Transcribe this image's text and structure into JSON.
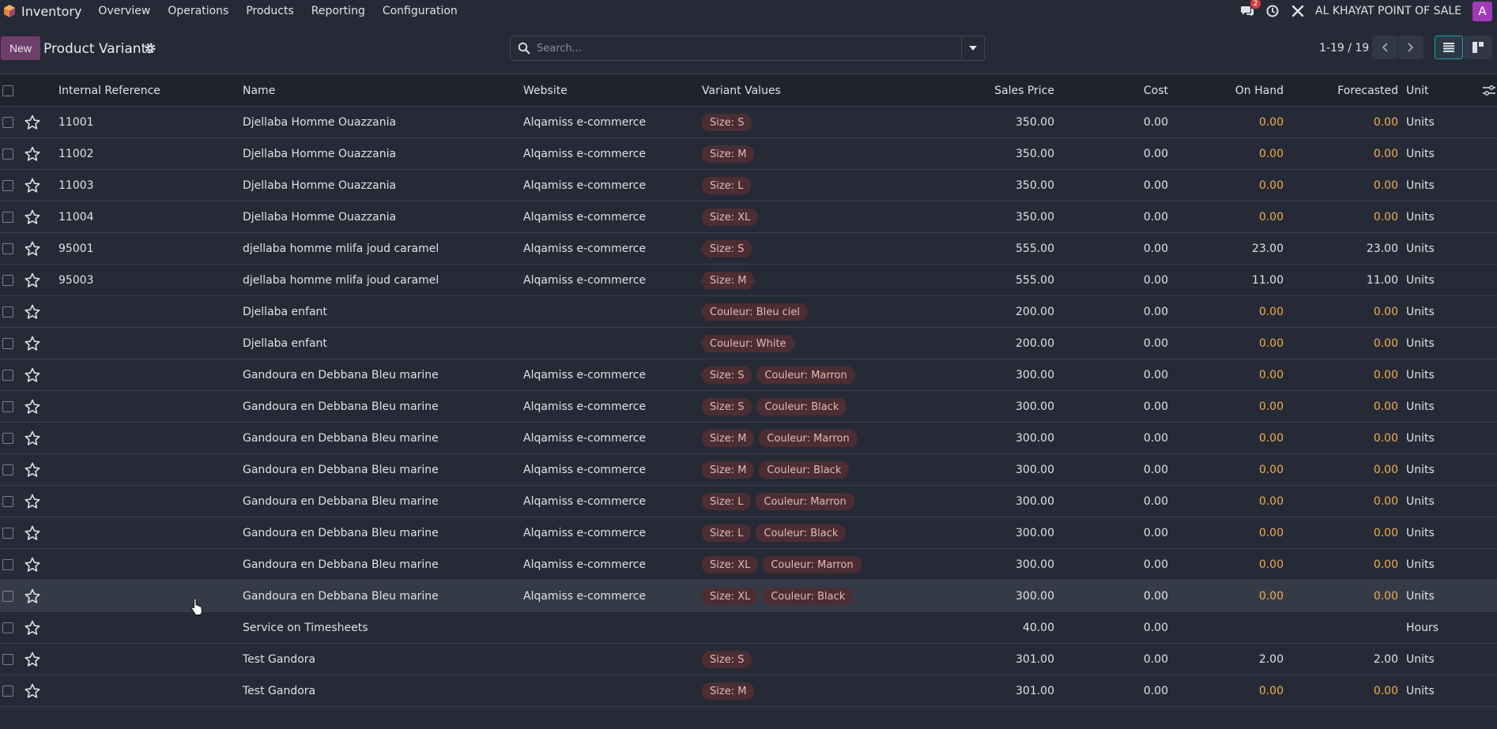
{
  "topnav": {
    "app_name": "Inventory",
    "menu": [
      "Overview",
      "Operations",
      "Products",
      "Reporting",
      "Configuration"
    ],
    "messages_badge": "2",
    "company": "AL KHAYAT POINT OF SALE",
    "avatar_letter": "A"
  },
  "control": {
    "new_label": "New",
    "title": "Product Variants",
    "search_placeholder": "Search...",
    "pager": "1-19 / 19"
  },
  "columns": {
    "internal_reference": "Internal Reference",
    "name": "Name",
    "website": "Website",
    "variant_values": "Variant Values",
    "sales_price": "Sales Price",
    "cost": "Cost",
    "on_hand": "On Hand",
    "forecasted": "Forecasted",
    "unit": "Unit"
  },
  "rows": [
    {
      "ref": "11001",
      "name": "Djellaba Homme Ouazzania",
      "website": "Alqamiss e-commerce",
      "tags": [
        "Size: S"
      ],
      "price": "350.00",
      "cost": "0.00",
      "on_hand": "0.00",
      "forecasted": "0.00",
      "unit": "Units",
      "warn": true
    },
    {
      "ref": "11002",
      "name": "Djellaba Homme Ouazzania",
      "website": "Alqamiss e-commerce",
      "tags": [
        "Size: M"
      ],
      "price": "350.00",
      "cost": "0.00",
      "on_hand": "0.00",
      "forecasted": "0.00",
      "unit": "Units",
      "warn": true
    },
    {
      "ref": "11003",
      "name": "Djellaba Homme Ouazzania",
      "website": "Alqamiss e-commerce",
      "tags": [
        "Size: L"
      ],
      "price": "350.00",
      "cost": "0.00",
      "on_hand": "0.00",
      "forecasted": "0.00",
      "unit": "Units",
      "warn": true
    },
    {
      "ref": "11004",
      "name": "Djellaba Homme Ouazzania",
      "website": "Alqamiss e-commerce",
      "tags": [
        "Size: XL"
      ],
      "price": "350.00",
      "cost": "0.00",
      "on_hand": "0.00",
      "forecasted": "0.00",
      "unit": "Units",
      "warn": true
    },
    {
      "ref": "95001",
      "name": "djellaba homme mlifa joud caramel",
      "website": "Alqamiss e-commerce",
      "tags": [
        "Size: S"
      ],
      "price": "555.00",
      "cost": "0.00",
      "on_hand": "23.00",
      "forecasted": "23.00",
      "unit": "Units",
      "warn": false
    },
    {
      "ref": "95003",
      "name": "djellaba homme mlifa joud caramel",
      "website": "Alqamiss e-commerce",
      "tags": [
        "Size: M"
      ],
      "price": "555.00",
      "cost": "0.00",
      "on_hand": "11.00",
      "forecasted": "11.00",
      "unit": "Units",
      "warn": false
    },
    {
      "ref": "",
      "name": "Djellaba enfant",
      "website": "",
      "tags": [
        "Couleur: Bleu ciel"
      ],
      "price": "200.00",
      "cost": "0.00",
      "on_hand": "0.00",
      "forecasted": "0.00",
      "unit": "Units",
      "warn": true
    },
    {
      "ref": "",
      "name": "Djellaba enfant",
      "website": "",
      "tags": [
        "Couleur: White"
      ],
      "price": "200.00",
      "cost": "0.00",
      "on_hand": "0.00",
      "forecasted": "0.00",
      "unit": "Units",
      "warn": true
    },
    {
      "ref": "",
      "name": "Gandoura en Debbana Bleu marine",
      "website": "Alqamiss e-commerce",
      "tags": [
        "Size: S",
        "Couleur: Marron"
      ],
      "price": "300.00",
      "cost": "0.00",
      "on_hand": "0.00",
      "forecasted": "0.00",
      "unit": "Units",
      "warn": true
    },
    {
      "ref": "",
      "name": "Gandoura en Debbana Bleu marine",
      "website": "Alqamiss e-commerce",
      "tags": [
        "Size: S",
        "Couleur: Black"
      ],
      "price": "300.00",
      "cost": "0.00",
      "on_hand": "0.00",
      "forecasted": "0.00",
      "unit": "Units",
      "warn": true
    },
    {
      "ref": "",
      "name": "Gandoura en Debbana Bleu marine",
      "website": "Alqamiss e-commerce",
      "tags": [
        "Size: M",
        "Couleur: Marron"
      ],
      "price": "300.00",
      "cost": "0.00",
      "on_hand": "0.00",
      "forecasted": "0.00",
      "unit": "Units",
      "warn": true
    },
    {
      "ref": "",
      "name": "Gandoura en Debbana Bleu marine",
      "website": "Alqamiss e-commerce",
      "tags": [
        "Size: M",
        "Couleur: Black"
      ],
      "price": "300.00",
      "cost": "0.00",
      "on_hand": "0.00",
      "forecasted": "0.00",
      "unit": "Units",
      "warn": true
    },
    {
      "ref": "",
      "name": "Gandoura en Debbana Bleu marine",
      "website": "Alqamiss e-commerce",
      "tags": [
        "Size: L",
        "Couleur: Marron"
      ],
      "price": "300.00",
      "cost": "0.00",
      "on_hand": "0.00",
      "forecasted": "0.00",
      "unit": "Units",
      "warn": true
    },
    {
      "ref": "",
      "name": "Gandoura en Debbana Bleu marine",
      "website": "Alqamiss e-commerce",
      "tags": [
        "Size: L",
        "Couleur: Black"
      ],
      "price": "300.00",
      "cost": "0.00",
      "on_hand": "0.00",
      "forecasted": "0.00",
      "unit": "Units",
      "warn": true
    },
    {
      "ref": "",
      "name": "Gandoura en Debbana Bleu marine",
      "website": "Alqamiss e-commerce",
      "tags": [
        "Size: XL",
        "Couleur: Marron"
      ],
      "price": "300.00",
      "cost": "0.00",
      "on_hand": "0.00",
      "forecasted": "0.00",
      "unit": "Units",
      "warn": true
    },
    {
      "ref": "",
      "name": "Gandoura en Debbana Bleu marine",
      "website": "Alqamiss e-commerce",
      "tags": [
        "Size: XL",
        "Couleur: Black"
      ],
      "price": "300.00",
      "cost": "0.00",
      "on_hand": "0.00",
      "forecasted": "0.00",
      "unit": "Units",
      "warn": true,
      "hover": true
    },
    {
      "ref": "",
      "name": "Service on Timesheets",
      "website": "",
      "tags": [],
      "price": "40.00",
      "cost": "0.00",
      "on_hand": "",
      "forecasted": "",
      "unit": "Hours",
      "warn": false
    },
    {
      "ref": "",
      "name": "Test Gandora",
      "website": "",
      "tags": [
        "Size: S"
      ],
      "price": "301.00",
      "cost": "0.00",
      "on_hand": "2.00",
      "forecasted": "2.00",
      "unit": "Units",
      "warn": false
    },
    {
      "ref": "",
      "name": "Test Gandora",
      "website": "",
      "tags": [
        "Size: M"
      ],
      "price": "301.00",
      "cost": "0.00",
      "on_hand": "0.00",
      "forecasted": "0.00",
      "unit": "Units",
      "warn": true
    }
  ],
  "colors": {
    "background": "#262a36",
    "accent": "#6e3f6b",
    "warning": "#f0ad4e",
    "tag_bg": "#4a2e33",
    "view_active": "#17a2b8"
  }
}
